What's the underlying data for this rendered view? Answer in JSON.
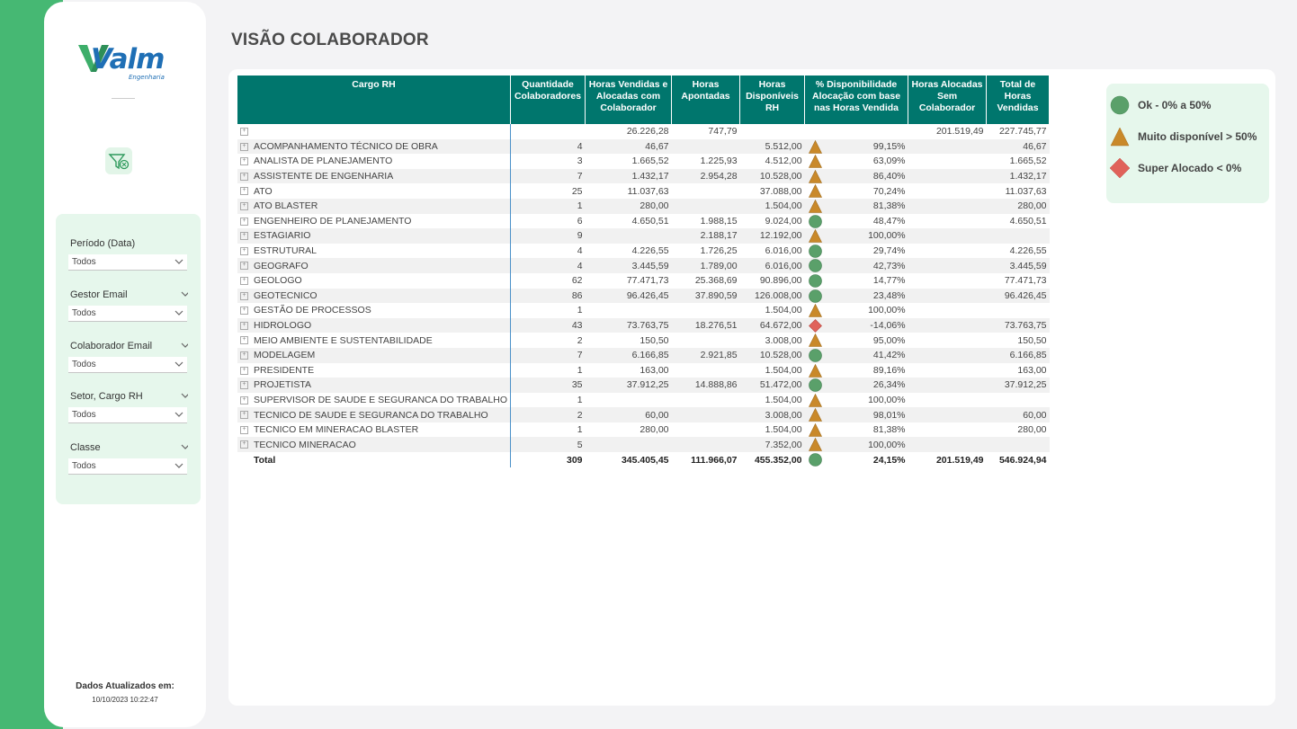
{
  "brand": {
    "name": "Valm",
    "sub": "Engenharia"
  },
  "page_title": "VISÃO COLABORADOR",
  "filters": [
    {
      "label": "Período (Data)",
      "value": "Todos"
    },
    {
      "label": "Gestor Email",
      "value": "Todos"
    },
    {
      "label": "Colaborador Email",
      "value": "Todos"
    },
    {
      "label": "Setor, Cargo RH",
      "value": "Todos"
    },
    {
      "label": "Classe",
      "value": "Todos"
    }
  ],
  "updated": {
    "label": "Dados Atualizados em:",
    "value": "10/10/2023 10:22:47"
  },
  "table": {
    "headers": [
      "Cargo RH",
      "Quantidade Colaboradores",
      "Horas Vendidas e Alocadas com Colaborador",
      "Horas Apontadas",
      "Horas Disponíveis RH",
      "% Disponibilidade Alocação com base nas Horas Vendida",
      "Horas Alocadas Sem Colaborador",
      "Total de Horas Vendidas"
    ],
    "rows": [
      {
        "cargo": "",
        "qtd": "",
        "vend": "26.226,28",
        "apont": "747,79",
        "disp": "",
        "status": "",
        "pct": "",
        "sem": "201.519,49",
        "total": "227.745,77"
      },
      {
        "cargo": "ACOMPANHAMENTO TÉCNICO DE OBRA",
        "qtd": "4",
        "vend": "46,67",
        "apont": "",
        "disp": "5.512,00",
        "status": "triangle",
        "pct": "99,15%",
        "sem": "",
        "total": "46,67"
      },
      {
        "cargo": "ANALISTA DE PLANEJAMENTO",
        "qtd": "3",
        "vend": "1.665,52",
        "apont": "1.225,93",
        "disp": "4.512,00",
        "status": "triangle",
        "pct": "63,09%",
        "sem": "",
        "total": "1.665,52"
      },
      {
        "cargo": "ASSISTENTE DE ENGENHARIA",
        "qtd": "7",
        "vend": "1.432,17",
        "apont": "2.954,28",
        "disp": "10.528,00",
        "status": "triangle",
        "pct": "86,40%",
        "sem": "",
        "total": "1.432,17"
      },
      {
        "cargo": "ATO",
        "qtd": "25",
        "vend": "11.037,63",
        "apont": "",
        "disp": "37.088,00",
        "status": "triangle",
        "pct": "70,24%",
        "sem": "",
        "total": "11.037,63"
      },
      {
        "cargo": "ATO BLASTER",
        "qtd": "1",
        "vend": "280,00",
        "apont": "",
        "disp": "1.504,00",
        "status": "triangle",
        "pct": "81,38%",
        "sem": "",
        "total": "280,00"
      },
      {
        "cargo": "ENGENHEIRO DE PLANEJAMENTO",
        "qtd": "6",
        "vend": "4.650,51",
        "apont": "1.988,15",
        "disp": "9.024,00",
        "status": "circle",
        "pct": "48,47%",
        "sem": "",
        "total": "4.650,51"
      },
      {
        "cargo": "ESTAGIARIO",
        "qtd": "9",
        "vend": "",
        "apont": "2.188,17",
        "disp": "12.192,00",
        "status": "triangle",
        "pct": "100,00%",
        "sem": "",
        "total": ""
      },
      {
        "cargo": "ESTRUTURAL",
        "qtd": "4",
        "vend": "4.226,55",
        "apont": "1.726,25",
        "disp": "6.016,00",
        "status": "circle",
        "pct": "29,74%",
        "sem": "",
        "total": "4.226,55"
      },
      {
        "cargo": "GEOGRAFO",
        "qtd": "4",
        "vend": "3.445,59",
        "apont": "1.789,00",
        "disp": "6.016,00",
        "status": "circle",
        "pct": "42,73%",
        "sem": "",
        "total": "3.445,59"
      },
      {
        "cargo": "GEOLOGO",
        "qtd": "62",
        "vend": "77.471,73",
        "apont": "25.368,69",
        "disp": "90.896,00",
        "status": "circle",
        "pct": "14,77%",
        "sem": "",
        "total": "77.471,73"
      },
      {
        "cargo": "GEOTECNICO",
        "qtd": "86",
        "vend": "96.426,45",
        "apont": "37.890,59",
        "disp": "126.008,00",
        "status": "circle",
        "pct": "23,48%",
        "sem": "",
        "total": "96.426,45"
      },
      {
        "cargo": "GESTÃO DE PROCESSOS",
        "qtd": "1",
        "vend": "",
        "apont": "",
        "disp": "1.504,00",
        "status": "triangle",
        "pct": "100,00%",
        "sem": "",
        "total": ""
      },
      {
        "cargo": "HIDROLOGO",
        "qtd": "43",
        "vend": "73.763,75",
        "apont": "18.276,51",
        "disp": "64.672,00",
        "status": "diamond",
        "pct": "-14,06%",
        "sem": "",
        "total": "73.763,75"
      },
      {
        "cargo": "MEIO AMBIENTE E SUSTENTABILIDADE",
        "qtd": "2",
        "vend": "150,50",
        "apont": "",
        "disp": "3.008,00",
        "status": "triangle",
        "pct": "95,00%",
        "sem": "",
        "total": "150,50"
      },
      {
        "cargo": "MODELAGEM",
        "qtd": "7",
        "vend": "6.166,85",
        "apont": "2.921,85",
        "disp": "10.528,00",
        "status": "circle",
        "pct": "41,42%",
        "sem": "",
        "total": "6.166,85"
      },
      {
        "cargo": "PRESIDENTE",
        "qtd": "1",
        "vend": "163,00",
        "apont": "",
        "disp": "1.504,00",
        "status": "triangle",
        "pct": "89,16%",
        "sem": "",
        "total": "163,00"
      },
      {
        "cargo": "PROJETISTA",
        "qtd": "35",
        "vend": "37.912,25",
        "apont": "14.888,86",
        "disp": "51.472,00",
        "status": "circle",
        "pct": "26,34%",
        "sem": "",
        "total": "37.912,25"
      },
      {
        "cargo": "SUPERVISOR DE SAUDE E SEGURANCA DO TRABALHO",
        "qtd": "1",
        "vend": "",
        "apont": "",
        "disp": "1.504,00",
        "status": "triangle",
        "pct": "100,00%",
        "sem": "",
        "total": ""
      },
      {
        "cargo": "TECNICO DE SAUDE E SEGURANCA DO TRABALHO",
        "qtd": "2",
        "vend": "60,00",
        "apont": "",
        "disp": "3.008,00",
        "status": "triangle",
        "pct": "98,01%",
        "sem": "",
        "total": "60,00"
      },
      {
        "cargo": "TECNICO EM MINERACAO BLASTER",
        "qtd": "1",
        "vend": "280,00",
        "apont": "",
        "disp": "1.504,00",
        "status": "triangle",
        "pct": "81,38%",
        "sem": "",
        "total": "280,00"
      },
      {
        "cargo": "TECNICO MINERACAO",
        "qtd": "5",
        "vend": "",
        "apont": "",
        "disp": "7.352,00",
        "status": "triangle",
        "pct": "100,00%",
        "sem": "",
        "total": ""
      }
    ],
    "total": {
      "cargo": "Total",
      "qtd": "309",
      "vend": "345.405,45",
      "apont": "111.966,07",
      "disp": "455.352,00",
      "status": "circle",
      "pct": "24,15%",
      "sem": "201.519,49",
      "total": "546.924,94"
    }
  },
  "legend": [
    {
      "shape": "circle",
      "label": "Ok - 0% a 50%"
    },
    {
      "shape": "triangle",
      "label": "Muito disponível > 50%"
    },
    {
      "shape": "diamond",
      "label": "Super Alocado < 0%"
    }
  ],
  "colors": {
    "circle": "#5aa06a",
    "triangle": "#c9892a",
    "diamond": "#e0625a",
    "header": "#00766d",
    "accent": "#46b873"
  }
}
